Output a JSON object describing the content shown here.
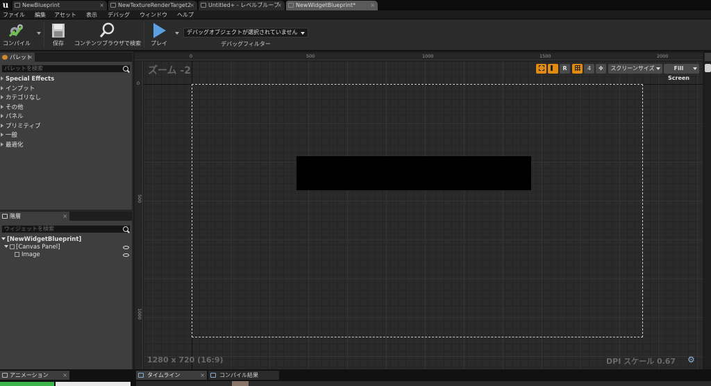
{
  "tabs": [
    {
      "label": "NewBlueprint",
      "active": false
    },
    {
      "label": "NewTextureRenderTarget2",
      "active": false
    },
    {
      "label": "Untitled+ - レベルブループ",
      "active": false
    },
    {
      "label": "NewWidgetBlueprint*",
      "active": true
    }
  ],
  "menu": [
    "ファイル",
    "編集",
    "アセット",
    "表示",
    "デバッグ",
    "ウィンドウ",
    "ヘルプ"
  ],
  "toolbar": {
    "compile": "コンパイル",
    "save": "保存",
    "browse": "コンテンツブラウザで検索",
    "play": "プレイ",
    "debug_select": "デバッグオブジェクトが選択されていません",
    "debug_filter": "デバッグフィルター"
  },
  "palette": {
    "title": "パレット",
    "search_placeholder": "パレットを検索",
    "categories": [
      "Special Effects",
      "インプット",
      "カテゴリなし",
      "その他",
      "パネル",
      "プリミティブ",
      "一般",
      "最適化"
    ]
  },
  "hierarchy": {
    "title": "階層",
    "search_placeholder": "ウィジェットを検索",
    "root": "[NewWidgetBlueprint]",
    "canvas": "[Canvas Panel]",
    "image": "Image"
  },
  "viewport": {
    "zoom": "ズーム -2",
    "resolution": "1280 x 720 (16:9)",
    "dpi": "DPI スケール 0.67",
    "r_button": "R",
    "grid_value": "4",
    "screen_size": "スクリーンサイズ",
    "fill_screen": "Fill Screen",
    "ruler_top": [
      "0",
      "500",
      "1000",
      "1500",
      "2000"
    ],
    "ruler_left": [
      "0",
      "500",
      "1000"
    ]
  },
  "bottom": {
    "animation": "アニメーション",
    "timeline": "タイムライン",
    "compile_results": "コンパイル結果"
  },
  "colors": {
    "accent_orange": "#e08a12",
    "play_blue": "#4a90d9",
    "canvas_bg": "#2c2c2c",
    "image_fill": "#000000"
  }
}
